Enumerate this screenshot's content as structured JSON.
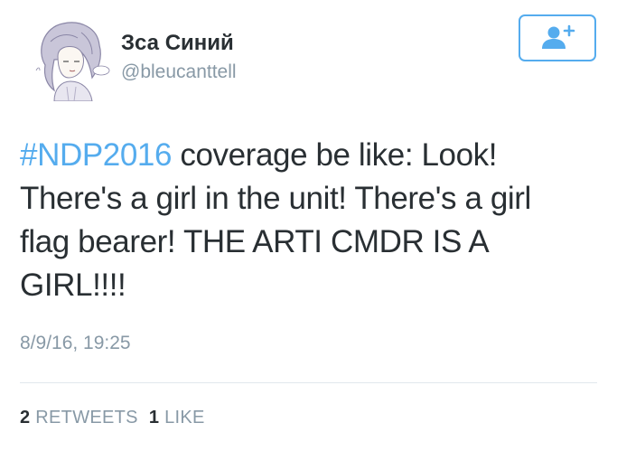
{
  "user": {
    "display_name": "Зса Синий",
    "handle": "@bleucanttell"
  },
  "follow_button": {
    "icon": "add-user-icon",
    "color": "#55acee"
  },
  "tweet": {
    "hashtag": "#NDP2016",
    "line1_rest": " coverage be like: Look!",
    "line2": "There's a girl in the unit! There's a girl",
    "line3": "flag bearer! THE ARTI CMDR IS A",
    "line4": "GIRL!!!!"
  },
  "timestamp": "8/9/16, 19:25",
  "stats": {
    "retweets_count": "2",
    "retweets_label": "RETWEETS",
    "likes_count": "1",
    "likes_label": "LIKE"
  }
}
